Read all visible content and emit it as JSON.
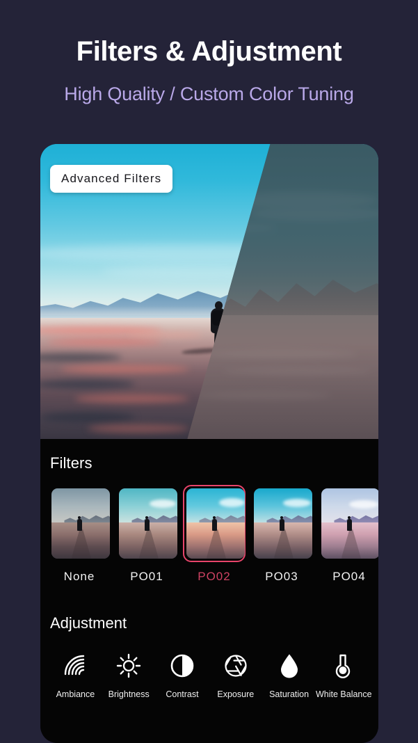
{
  "header": {
    "title": "Filters & Adjustment",
    "subtitle": "High Quality / Custom Color Tuning"
  },
  "colors": {
    "page_background": "#242338",
    "card_background": "#050505",
    "title": "#ffffff",
    "subtitle": "#b9a8e8",
    "accent_selected": "#e8446a",
    "selected_label": "#cf4263",
    "badge_background": "#ffffff",
    "badge_text": "#15151a"
  },
  "hero": {
    "badge_label": "Advanced Filters",
    "image_alt": "Lone hiker with backpack walking across a desert salt flat toward distant mountains, split diagonally between a bright cyan-and-pink filtered look on the left and a darker desaturated teal-brown look on the right"
  },
  "filters": {
    "section_title": "Filters",
    "items": [
      {
        "label": "None",
        "selected": false
      },
      {
        "label": "PO01",
        "selected": false
      },
      {
        "label": "PO02",
        "selected": true
      },
      {
        "label": "PO03",
        "selected": false
      },
      {
        "label": "PO04",
        "selected": false
      }
    ]
  },
  "adjustment": {
    "section_title": "Adjustment",
    "items": [
      {
        "label": "Ambiance",
        "icon": "ambiance-arcs-icon"
      },
      {
        "label": "Brightness",
        "icon": "sun-icon"
      },
      {
        "label": "Contrast",
        "icon": "contrast-half-circle-icon"
      },
      {
        "label": "Exposure",
        "icon": "aperture-icon"
      },
      {
        "label": "Saturation",
        "icon": "droplet-icon"
      },
      {
        "label": "White Balance",
        "icon": "thermometer-bulb-icon"
      }
    ]
  }
}
